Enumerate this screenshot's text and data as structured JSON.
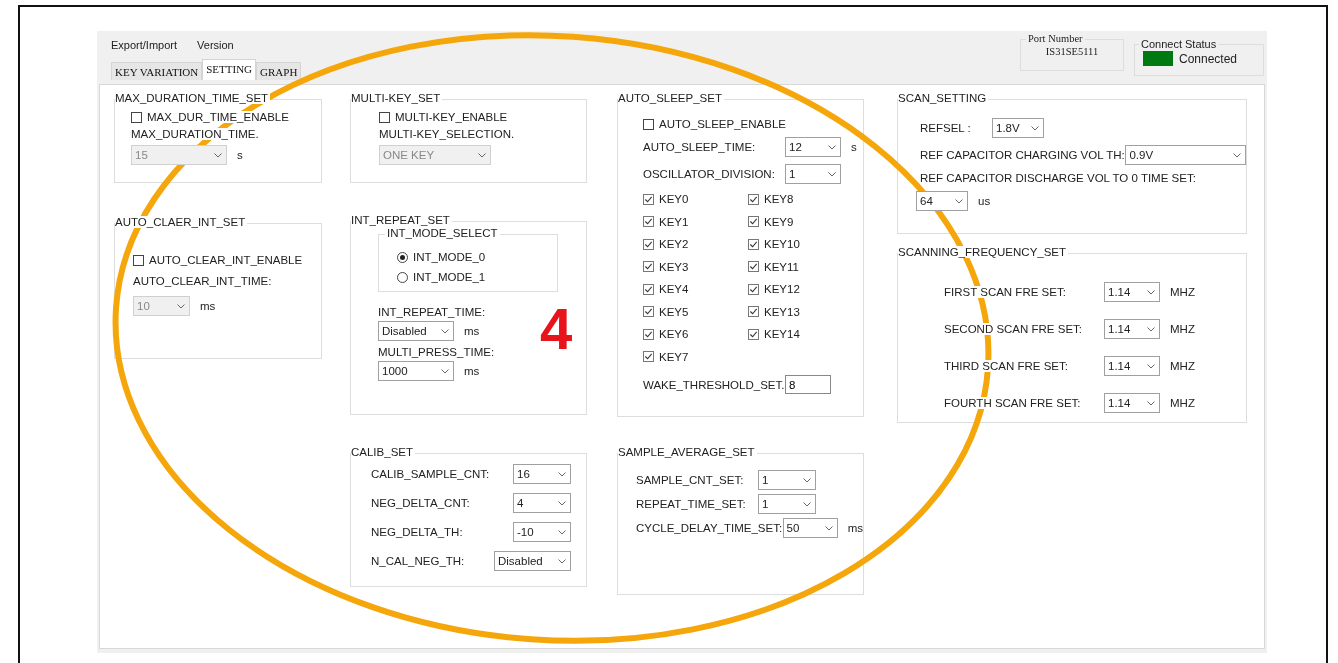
{
  "menu": [
    "Export/Import",
    "Version"
  ],
  "tabs": [
    {
      "label": "KEY VARIATION",
      "selected": false
    },
    {
      "label": "SETTING",
      "selected": true
    },
    {
      "label": "GRAPH",
      "selected": false
    }
  ],
  "port": {
    "label": "Port Number",
    "value": "IS31SE5111"
  },
  "connect": {
    "label": "Connect Status",
    "status": "Connected",
    "connected": true
  },
  "columns": [
    [
      {
        "title": "MAX_DURATION_TIME_SET",
        "items": [
          {
            "kind": "checkbox",
            "label": "MAX_DUR_TIME_ENABLE",
            "checked": false
          },
          {
            "kind": "caption",
            "text": "MAX_DURATION_TIME."
          },
          {
            "kind": "select",
            "value": "15",
            "unit": "s",
            "disabled": true
          }
        ]
      },
      {
        "title": "AUTO_CLAER_INT_SET",
        "items": [
          {
            "kind": "checkbox",
            "label": "AUTO_CLEAR_INT_ENABLE",
            "checked": false
          },
          {
            "kind": "caption",
            "text": "AUTO_CLEAR_INT_TIME:"
          },
          {
            "kind": "select",
            "value": "10",
            "unit": "ms",
            "disabled": true
          }
        ]
      }
    ],
    [
      {
        "title": "MULTI-KEY_SET",
        "items": [
          {
            "kind": "checkbox",
            "label": "MULTI-KEY_ENABLE",
            "checked": false
          },
          {
            "kind": "caption",
            "text": "MULTI-KEY_SELECTION."
          },
          {
            "kind": "select",
            "value": "ONE KEY",
            "disabled": true
          }
        ]
      },
      {
        "title": "INT_REPEAT_SET",
        "items": [
          {
            "kind": "radio-group",
            "title": "INT_MODE_SELECT",
            "options": [
              {
                "label": "INT_MODE_0",
                "selected": true
              },
              {
                "label": "INT_MODE_1",
                "selected": false
              }
            ]
          },
          {
            "kind": "caption",
            "text": "INT_REPEAT_TIME:"
          },
          {
            "kind": "select",
            "value": "Disabled",
            "unit": "ms",
            "disabled": false
          },
          {
            "kind": "caption",
            "text": "MULTI_PRESS_TIME:"
          },
          {
            "kind": "select",
            "value": "1000",
            "unit": "ms",
            "disabled": false
          }
        ]
      },
      {
        "title": "CALIB_SET",
        "items": [
          {
            "kind": "select-row",
            "label": "CALIB_SAMPLE_CNT:",
            "value": "16",
            "disabled": false
          },
          {
            "kind": "select-row",
            "label": "NEG_DELTA_CNT:",
            "value": "4",
            "disabled": false
          },
          {
            "kind": "select-row",
            "label": "NEG_DELTA_TH:",
            "value": "-10",
            "disabled": false
          },
          {
            "kind": "select-row",
            "label": "N_CAL_NEG_TH:",
            "value": "Disabled",
            "disabled": false
          }
        ]
      }
    ],
    [
      {
        "title": "AUTO_SLEEP_SET",
        "items": [
          {
            "kind": "checkbox",
            "label": "AUTO_SLEEP_ENABLE",
            "checked": false
          },
          {
            "kind": "select-row",
            "label": "AUTO_SLEEP_TIME:",
            "value": "12",
            "unit": "s",
            "disabled": false
          },
          {
            "kind": "select-row",
            "label": "OSCILLATOR_DIVISION:",
            "value": "1",
            "disabled": false
          },
          {
            "kind": "key-grid",
            "keys": [
              {
                "label": "KEY0",
                "checked": true
              },
              {
                "label": "KEY1",
                "checked": true
              },
              {
                "label": "KEY2",
                "checked": true
              },
              {
                "label": "KEY3",
                "checked": true
              },
              {
                "label": "KEY4",
                "checked": true
              },
              {
                "label": "KEY5",
                "checked": true
              },
              {
                "label": "KEY6",
                "checked": true
              },
              {
                "label": "KEY7",
                "checked": true
              },
              {
                "label": "KEY8",
                "checked": true
              },
              {
                "label": "KEY9",
                "checked": true
              },
              {
                "label": "KEY10",
                "checked": true
              },
              {
                "label": "KEY11",
                "checked": true
              },
              {
                "label": "KEY12",
                "checked": true
              },
              {
                "label": "KEY13",
                "checked": true
              },
              {
                "label": "KEY14",
                "checked": true
              }
            ]
          },
          {
            "kind": "input-row",
            "label": "WAKE_THRESHOLD_SET.",
            "value": "8"
          }
        ]
      },
      {
        "title": "SAMPLE_AVERAGE_SET",
        "items": [
          {
            "kind": "select-row",
            "label": "SAMPLE_CNT_SET:",
            "value": "1",
            "disabled": false
          },
          {
            "kind": "select-row",
            "label": "REPEAT_TIME_SET:",
            "value": "1",
            "disabled": false
          },
          {
            "kind": "select-row",
            "label": "CYCLE_DELAY_TIME_SET:",
            "value": "50",
            "unit": "ms",
            "disabled": false
          }
        ]
      }
    ],
    [
      {
        "title": "SCAN_SETTING",
        "items": [
          {
            "kind": "select-row",
            "label": "REFSEL :",
            "value": "1.8V",
            "disabled": false
          },
          {
            "kind": "select-row",
            "label": "REF CAPACITOR CHARGING VOL TH:",
            "value": "0.9V",
            "disabled": false
          },
          {
            "kind": "caption",
            "text": "REF CAPACITOR DISCHARGE VOL TO 0 TIME SET:"
          },
          {
            "kind": "select",
            "value": "64",
            "unit": "us",
            "disabled": false
          }
        ]
      },
      {
        "title": "SCANNING_FREQUENCY_SET",
        "items": [
          {
            "kind": "select-row",
            "label": "FIRST SCAN FRE SET:",
            "value": "1.14",
            "unit": "MHZ",
            "disabled": false
          },
          {
            "kind": "select-row",
            "label": "SECOND SCAN FRE SET:",
            "value": "1.14",
            "unit": "MHZ",
            "disabled": false
          },
          {
            "kind": "select-row",
            "label": "THIRD SCAN FRE SET:",
            "value": "1.14",
            "unit": "MHZ",
            "disabled": false
          },
          {
            "kind": "select-row",
            "label": "FOURTH SCAN FRE SET:",
            "value": "1.14",
            "unit": "MHZ",
            "disabled": false
          }
        ]
      }
    ]
  ],
  "annotation": {
    "label": "4"
  }
}
